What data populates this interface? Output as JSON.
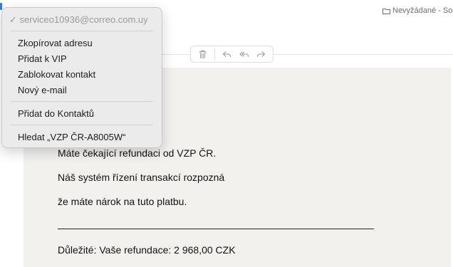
{
  "header": {
    "mailbox_label": "Nevyžádané - So"
  },
  "toolbar": {
    "icons": [
      "trash-icon",
      "reply-icon",
      "reply-all-icon",
      "forward-icon"
    ]
  },
  "context_menu": {
    "sender_check": "✓",
    "sender_address": "serviceo10936@correo.com.uy",
    "copy_address": "Zkopírovat adresu",
    "add_vip": "Přidat k VIP",
    "block_contact": "Zablokovat kontakt",
    "new_email": "Nový e-mail",
    "add_to_contacts": "Přidat do Kontaktů",
    "search": "Hledat „VZP ČR-A8005W“"
  },
  "email": {
    "line1": "Máte čekající refundaci od VZP ČR.",
    "line2": "Náš systém řízení transakcí rozpozná",
    "line3": " že máte nárok na tuto platbu.",
    "line4": "Důležité: Vaše refundace: 2 968,00 CZK"
  },
  "colors": {
    "menu_background": "#eaeaea",
    "email_background": "#f2f1ee",
    "accent": "#3a7bd5"
  }
}
